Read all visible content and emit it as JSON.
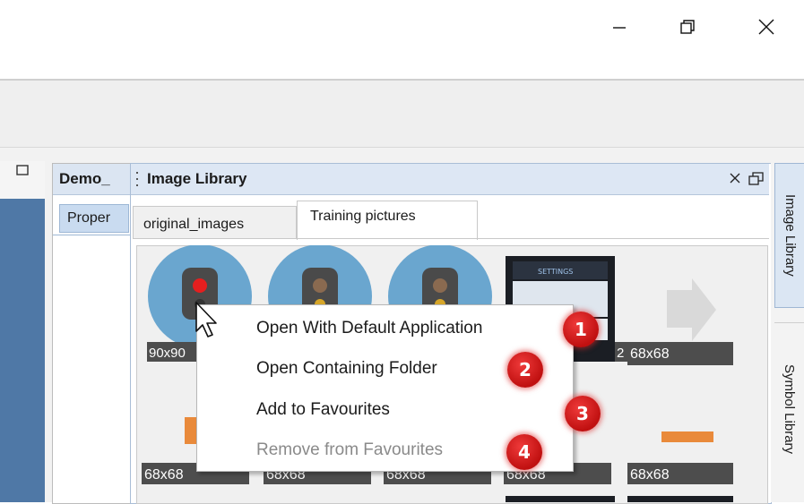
{
  "window": {
    "controls": {
      "minimize_icon": "minimize-icon",
      "restore_icon": "restore-icon",
      "close_icon": "close-icon"
    }
  },
  "demo_panel": {
    "title": "Demo_",
    "tab": "Proper"
  },
  "image_library": {
    "title": "Image Library",
    "tabs": [
      {
        "label": "original_images",
        "active": false
      },
      {
        "label": "Training pictures",
        "active": true
      }
    ],
    "thumbnails": [
      {
        "label": "90x90",
        "content": "traffic-light-red"
      },
      {
        "label": "",
        "content": "traffic-light-amber"
      },
      {
        "label": "",
        "content": "traffic-light-amber"
      },
      {
        "label": "2",
        "content": "settings-screen",
        "header_text": "SETTINGS"
      },
      {
        "label": "68x68",
        "content": "arrow-right"
      },
      {
        "label": "68x68",
        "content": "orange-bar"
      },
      {
        "label": "68x68",
        "content": ""
      },
      {
        "label": "68x68",
        "content": ""
      },
      {
        "label": "68x68",
        "content": ""
      },
      {
        "label": "68x68",
        "content": "orange-bar"
      }
    ]
  },
  "side_tabs": [
    {
      "label": "Image Library",
      "active": true
    },
    {
      "label": "Symbol Library",
      "active": false
    }
  ],
  "context_menu": {
    "items": [
      {
        "label": "Open With Default Application",
        "enabled": true
      },
      {
        "label": "Open Containing Folder",
        "enabled": true
      },
      {
        "label": "Add to Favourites",
        "enabled": true
      },
      {
        "label": "Remove from Favourites",
        "enabled": false
      }
    ]
  },
  "badges": [
    "1",
    "2",
    "3",
    "4"
  ],
  "colors": {
    "accent_blue": "#4f78a6",
    "header_blue": "#dde7f4",
    "badge_red": "#d42020",
    "thumb_circle": "#6aa6cf",
    "orange": "#e98a3b"
  }
}
